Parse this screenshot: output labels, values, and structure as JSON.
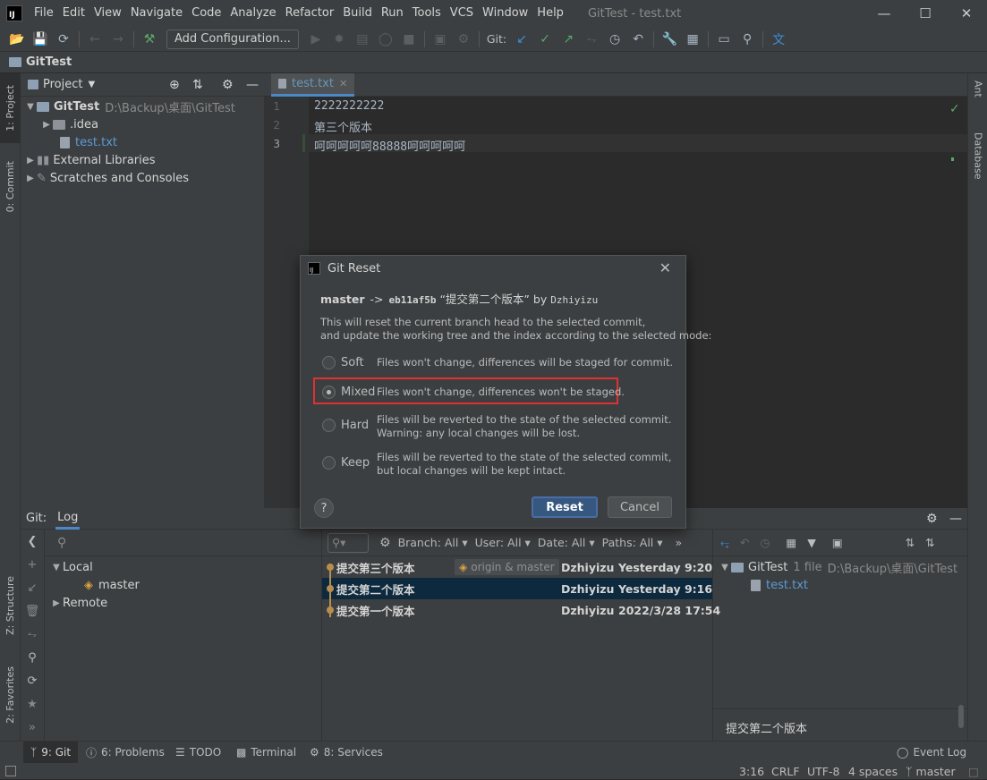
{
  "menubar": {
    "logo": "IJ",
    "items": [
      "File",
      "Edit",
      "View",
      "Navigate",
      "Code",
      "Analyze",
      "Refactor",
      "Build",
      "Run",
      "Tools",
      "VCS",
      "Window",
      "Help"
    ],
    "window_title": "GitTest - test.txt"
  },
  "toolbar": {
    "add_config": "Add Configuration...",
    "git_label": "Git:"
  },
  "navbar": {
    "project_name": "GitTest"
  },
  "left_stripe": {
    "project_tab": "1: Project",
    "commit_tab": "0: Commit",
    "structure_tab": "Z: Structure",
    "favorites_tab": "2: Favorites"
  },
  "right_stripe": {
    "ant_tab": "Ant",
    "database_tab": "Database"
  },
  "project_panel": {
    "title": "Project",
    "root": {
      "name": "GitTest",
      "path": "D:\\Backup\\桌面\\GitTest"
    },
    "idea_folder": ".idea",
    "file": "test.txt",
    "external_libs": "External Libraries",
    "scratches": "Scratches and Consoles"
  },
  "editor": {
    "tab": "test.txt",
    "lines": [
      {
        "num": "1",
        "text": "2222222222"
      },
      {
        "num": "2",
        "text": "第三个版本"
      },
      {
        "num": "3",
        "text": "呵呵呵呵呵88888呵呵呵呵呵"
      }
    ]
  },
  "dialog": {
    "title": "Git Reset",
    "branch": "master",
    "arrow": "->",
    "hash": "eb11af5b",
    "commit_msg": "“提交第二个版本”",
    "by": "by",
    "author": "Dzhiyizu",
    "desc1": "This will reset the current branch head to the selected commit,",
    "desc2": "and update the working tree and the index according to the selected mode:",
    "options": [
      {
        "label": "Soft",
        "desc1": "Files won't change, differences will be staged for commit.",
        "desc2": ""
      },
      {
        "label": "Mixed",
        "desc1": "Files won't change, differences won't be staged.",
        "desc2": ""
      },
      {
        "label": "Hard",
        "desc1": "Files will be reverted to the state of the selected commit.",
        "desc2": "Warning: any local changes will be lost."
      },
      {
        "label": "Keep",
        "desc1": "Files will be reverted to the state of the selected commit,",
        "desc2": "but local changes will be kept intact."
      }
    ],
    "selected": "Mixed",
    "help": "?",
    "reset_btn": "Reset",
    "cancel_btn": "Cancel"
  },
  "git_panel": {
    "label": "Git:",
    "tab": "Log",
    "branches": {
      "local": "Local",
      "master": "master",
      "remote": "Remote"
    },
    "filters": {
      "branch": "Branch: All",
      "user": "User: All",
      "date": "Date: All",
      "paths": "Paths: All",
      "more": "»"
    },
    "commits": [
      {
        "msg": "提交第三个版本",
        "tag": "origin & master",
        "author": "Dzhiyizu",
        "date": "Yesterday 9:20"
      },
      {
        "msg": "提交第二个版本",
        "tag": "",
        "author": "Dzhiyizu",
        "date": "Yesterday 9:16"
      },
      {
        "msg": "提交第一个版本",
        "tag": "",
        "author": "Dzhiyizu",
        "date": "2022/3/28 17:54"
      }
    ],
    "details": {
      "root": "GitTest",
      "count": "1 file",
      "path": "D:\\Backup\\桌面\\GitTest",
      "file": "test.txt",
      "message": "提交第二个版本"
    }
  },
  "status_tabs": {
    "git": "9: Git",
    "problems": "6: Problems",
    "todo": "TODO",
    "terminal": "Terminal",
    "services": "8: Services",
    "event_log": "Event Log"
  },
  "status_bar": {
    "position": "3:16",
    "line_sep": "CRLF",
    "encoding": "UTF-8",
    "indent": "4 spaces",
    "branch": "master"
  },
  "colors": {
    "accent": "#4a88c7",
    "highlight_border": "#e03131",
    "bg": "#2b2b2b",
    "panel": "#3c3f41"
  }
}
